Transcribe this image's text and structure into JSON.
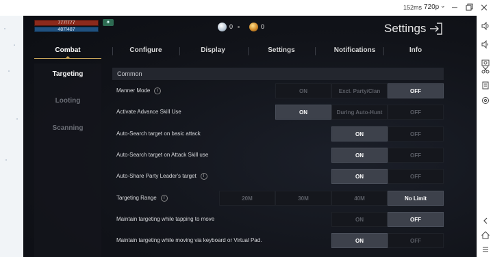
{
  "window": {
    "perf": "152ms",
    "resolution": "720p"
  },
  "hud": {
    "hp": "777/777",
    "mp": "487/487",
    "currency_1": "0",
    "currency_2": "0"
  },
  "page_title": "Settings",
  "tabs": [
    {
      "label": "Combat"
    },
    {
      "label": "Configure"
    },
    {
      "label": "Display"
    },
    {
      "label": "Settings"
    },
    {
      "label": "Notifications"
    },
    {
      "label": "Info"
    }
  ],
  "subnav": [
    {
      "label": "Targeting"
    },
    {
      "label": "Looting"
    },
    {
      "label": "Scanning"
    }
  ],
  "section": "Common",
  "rows": [
    {
      "label": "Manner Mode",
      "info": true,
      "options": [
        "ON",
        "Excl. Party/Clan",
        "OFF"
      ],
      "selected": 2
    },
    {
      "label": "Activate Advance Skill Use",
      "info": false,
      "options": [
        "ON",
        "During Auto-Hunt",
        "OFF"
      ],
      "selected": 0
    },
    {
      "label": "Auto-Search target on basic attack",
      "info": false,
      "options": [
        "ON",
        "OFF"
      ],
      "selected": 0
    },
    {
      "label": "Auto-Search target on Attack Skill use",
      "info": false,
      "options": [
        "ON",
        "OFF"
      ],
      "selected": 0
    },
    {
      "label": "Auto-Share Party Leader's target",
      "info": true,
      "options": [
        "ON",
        "OFF"
      ],
      "selected": 0
    },
    {
      "label": "Targeting Range",
      "info": true,
      "options": [
        "20M",
        "30M",
        "40M",
        "No Limit"
      ],
      "selected": 3
    },
    {
      "label": "Maintain targeting while tapping to move",
      "info": false,
      "options": [
        "ON",
        "OFF"
      ],
      "selected": 1
    },
    {
      "label": "Maintain targeting while moving via keyboard or Virtual Pad.",
      "info": false,
      "options": [
        "ON",
        "OFF"
      ],
      "selected": 0
    }
  ]
}
